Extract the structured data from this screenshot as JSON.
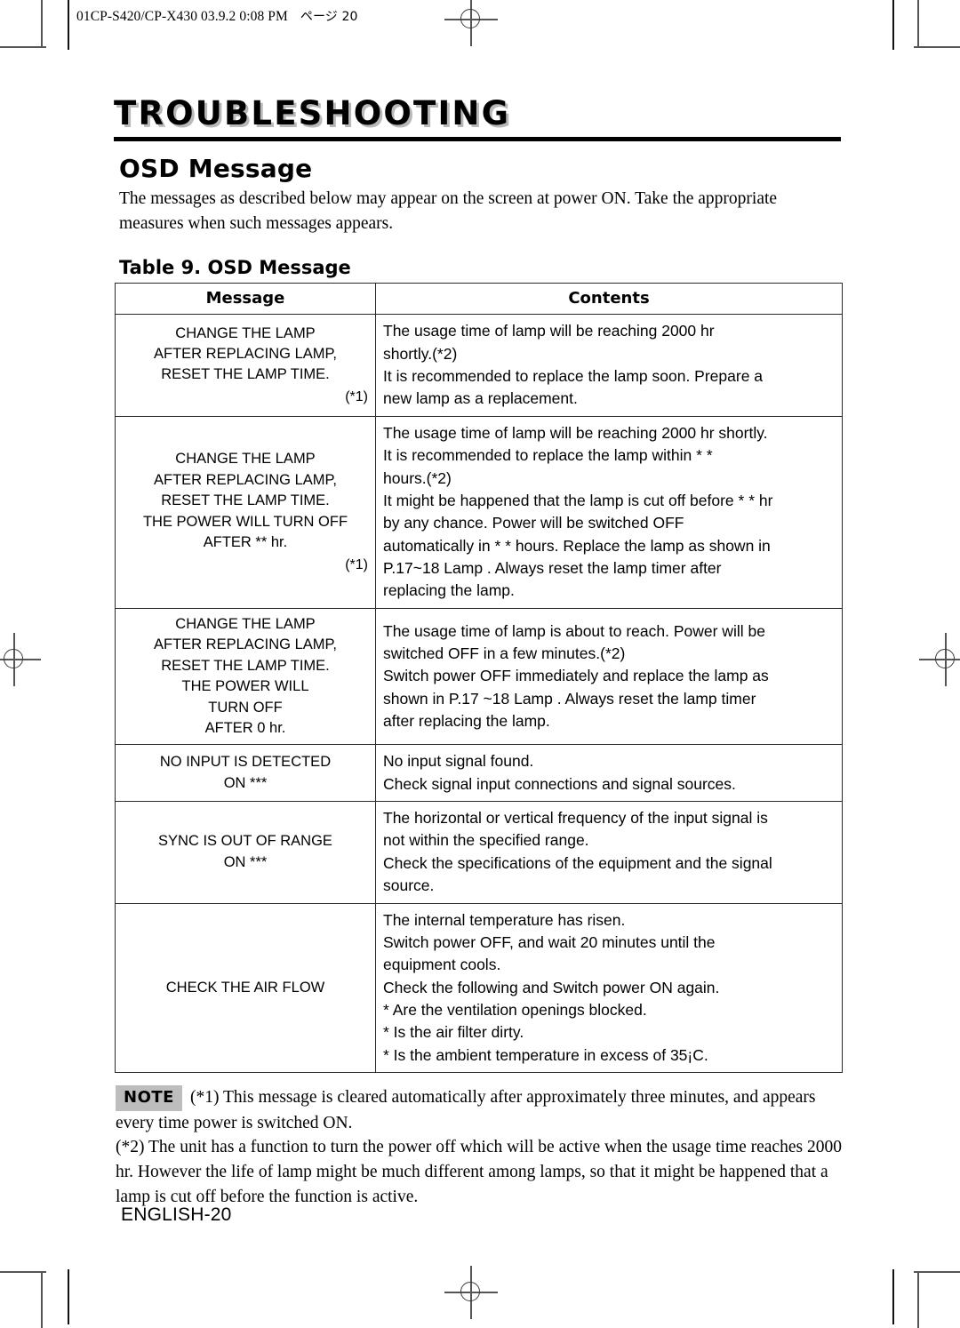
{
  "page": {
    "header_line": "01CP-S420/CP-X430  03.9.2 0:08 PM",
    "header_page_jp": "ページ 20",
    "footer": "ENGLISH-20"
  },
  "chapter": {
    "title": "TROUBLESHOOTING"
  },
  "section": {
    "title": "OSD Message",
    "intro": "The messages as described below may appear on the screen at power ON. Take the appropriate measures when such messages appears."
  },
  "table": {
    "caption": "Table 9. OSD Message",
    "headers": [
      "Message",
      "Contents"
    ],
    "rows": [
      {
        "message_lines": [
          "CHANGE THE LAMP",
          "AFTER REPLACING LAMP,",
          "RESET THE LAMP TIME."
        ],
        "message_note": "(*1)",
        "contents_lines": [
          "The usage time of lamp will be reaching 2000 hr",
          "shortly.(*2)",
          "It is recommended to replace the lamp soon.  Prepare a",
          "new lamp as a replacement."
        ]
      },
      {
        "message_lines": [
          "CHANGE THE LAMP",
          "AFTER REPLACING LAMP,",
          "RESET THE LAMP TIME.",
          "THE POWER WILL TURN OFF",
          "AFTER ** hr."
        ],
        "message_note": "(*1)",
        "contents_lines": [
          "The usage time of lamp will be reaching 2000 hr shortly.",
          "It is recommended to replace the lamp within * *",
          "hours.(*2)",
          "It might be happened that the lamp is cut off before * * hr",
          "by any chance.  Power will be switched OFF",
          "automatically in * * hours.  Replace the lamp as shown in",
          "P.17~18  Lamp .  Always reset the lamp timer after",
          "replacing the lamp."
        ]
      },
      {
        "message_lines": [
          "CHANGE THE LAMP",
          "AFTER REPLACING LAMP,",
          "RESET THE LAMP TIME.",
          "THE POWER WILL",
          "TURN OFF",
          "AFTER 0 hr."
        ],
        "message_note": "",
        "contents_lines": [
          "The usage time of lamp is about to reach.  Power will be",
          "switched OFF in a few minutes.(*2)",
          "Switch power OFF immediately and replace the lamp as",
          "shown in P.17 ~18  Lamp .  Always reset the lamp timer",
          "after replacing the lamp."
        ]
      },
      {
        "message_lines": [
          "NO INPUT IS DETECTED",
          "ON ***"
        ],
        "message_note": "",
        "contents_lines": [
          "No input signal found.",
          "Check signal input connections and signal sources."
        ]
      },
      {
        "message_lines": [
          "SYNC IS OUT OF RANGE",
          "ON ***"
        ],
        "message_note": "",
        "contents_lines": [
          "The horizontal or vertical frequency of the input signal is",
          "not within the specified range.",
          "Check the specifications of the equipment and the signal",
          "source."
        ]
      },
      {
        "message_lines": [
          "CHECK THE AIR FLOW"
        ],
        "message_note": "",
        "contents_lines": [
          "The internal temperature has risen.",
          "Switch power OFF, and wait 20 minutes until the",
          "equipment cools.",
          "Check the following and Switch power ON again.",
          "* Are the ventilation openings blocked.",
          "* Is the air filter dirty.",
          "* Is the ambient temperature in excess of 35¡C."
        ]
      }
    ]
  },
  "note": {
    "badge": "NOTE",
    "paragraph1": "(*1) This message is cleared automatically after approximately three minutes, and appears every time power is switched ON.",
    "paragraph2": "(*2) The unit has a function to turn the power off which will be active when the usage time reaches 2000 hr.  However the life of lamp might be much different among lamps, so that it might be happened that a lamp is cut off before the function is active."
  }
}
